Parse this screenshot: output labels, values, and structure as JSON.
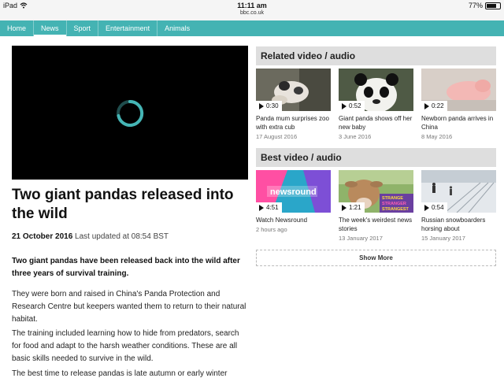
{
  "status_bar": {
    "device": "iPad",
    "time": "11:11 am",
    "url": "bbc.co.uk",
    "battery": "77%",
    "battery_level": 0.77
  },
  "nav": {
    "items": [
      {
        "label": "Home"
      },
      {
        "label": "News",
        "active": true
      },
      {
        "label": "Sport"
      },
      {
        "label": "Entertainment"
      },
      {
        "label": "Animals"
      }
    ]
  },
  "article": {
    "headline": "Two giant pandas released into the wild",
    "date": "21 October 2016",
    "updated": "Last updated at 08:54 BST",
    "paragraphs": [
      "Two giant pandas have been released back into the wild after three years of survival training.",
      "They were born and raised in China's Panda Protection and Research Centre but keepers wanted them to return to their natural habitat.",
      "The training included learning how to hide from predators, search for food and adapt to the harsh weather conditions. These are all basic skills needed to survive in the wild.",
      "The best time to release pandas is late autumn or early winter"
    ]
  },
  "related": {
    "title": "Related video / audio",
    "items": [
      {
        "duration": "0:30",
        "title": "Panda mum surprises zoo with extra cub",
        "date": "17 August 2016",
        "thumb": "panda-cub"
      },
      {
        "duration": "0:52",
        "title": "Giant panda shows off her new baby",
        "date": "3 June 2016",
        "thumb": "giant-panda"
      },
      {
        "duration": "0:22",
        "title": "Newborn panda arrives in China",
        "date": "8 May 2016",
        "thumb": "newborn-panda"
      }
    ]
  },
  "best": {
    "title": "Best video / audio",
    "items": [
      {
        "duration": "4:51",
        "title": "Watch Newsround",
        "date": "2 hours ago",
        "thumb": "newsround",
        "thumb_text": "newsround"
      },
      {
        "duration": "1:21",
        "title": "The week's weirdest news stories",
        "date": "13 January 2017",
        "thumb": "cow",
        "thumb_text": [
          "STRANGE",
          "STRANGER",
          "STRANGEST"
        ]
      },
      {
        "duration": "0:54",
        "title": "Russian snowboarders horsing about",
        "date": "15 January 2017",
        "thumb": "snowboarders"
      }
    ]
  },
  "show_more": "Show More"
}
